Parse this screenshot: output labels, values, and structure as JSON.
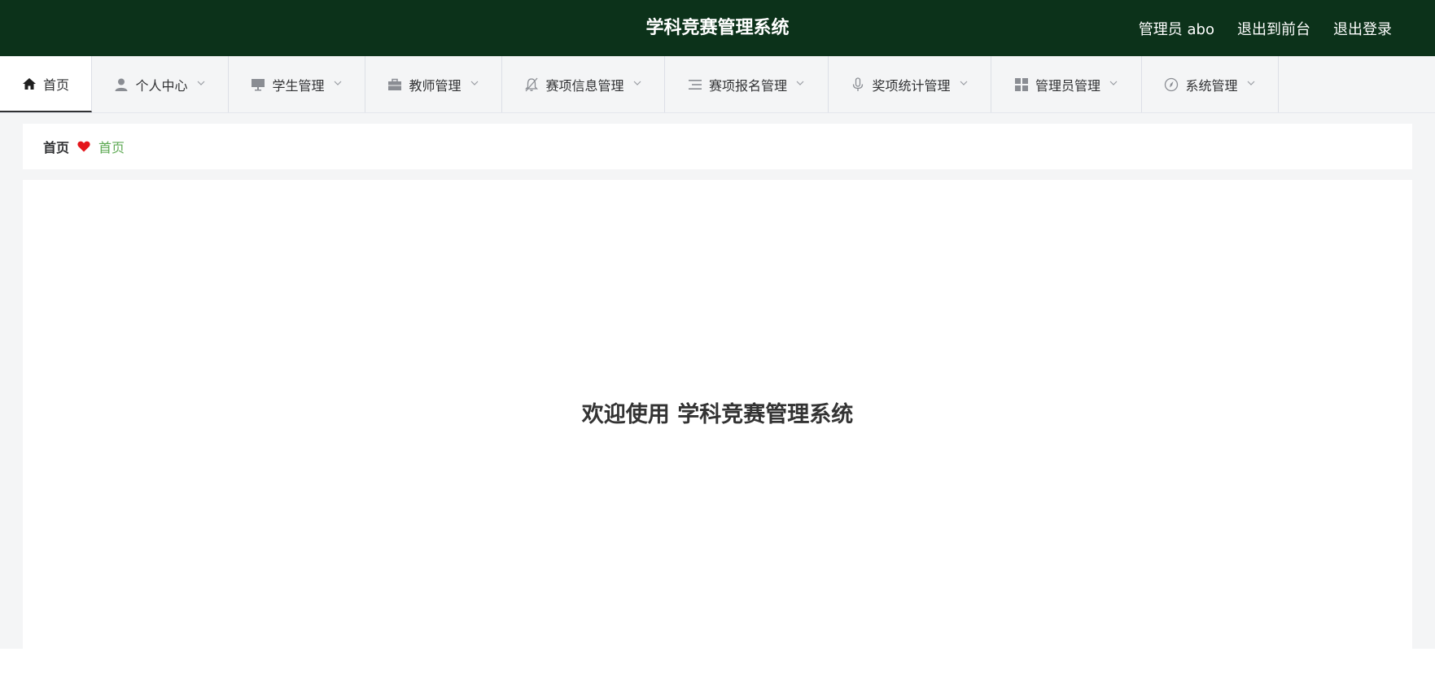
{
  "header": {
    "title": "学科竞赛管理系统",
    "user_label": "管理员 abo",
    "front_link": "退出到前台",
    "logout_link": "退出登录",
    "bg_color": "#0c321a"
  },
  "nav": {
    "items": [
      {
        "label": "首页",
        "icon": "home-icon"
      },
      {
        "label": "个人中心",
        "icon": "user-icon"
      },
      {
        "label": "学生管理",
        "icon": "monitor-icon"
      },
      {
        "label": "教师管理",
        "icon": "briefcase-icon"
      },
      {
        "label": "赛项信息管理",
        "icon": "bell-off-icon"
      },
      {
        "label": "赛项报名管理",
        "icon": "list-icon"
      },
      {
        "label": "奖项统计管理",
        "icon": "microphone-icon"
      },
      {
        "label": "管理员管理",
        "icon": "grid-icon"
      },
      {
        "label": "系统管理",
        "icon": "compass-icon"
      }
    ]
  },
  "breadcrumb": {
    "home": "首页",
    "current": "首页",
    "separator_icon": "heart-icon",
    "current_color": "#5eaa54"
  },
  "main": {
    "welcome": "欢迎使用 学科竞赛管理系统"
  }
}
